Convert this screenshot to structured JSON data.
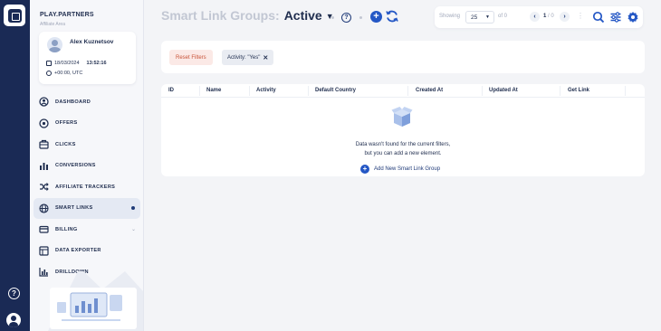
{
  "sidebar": {
    "brand": "PLAY.PARTNERS",
    "brand_sub": "Affiliate Area",
    "user": {
      "name": "Alex Kuznetsov",
      "date": "18/03/2024",
      "time": "13:52:16",
      "timezone": "+00:00, UTC"
    },
    "items": [
      {
        "label": "DASHBOARD",
        "icon": "dashboard-icon"
      },
      {
        "label": "OFFERS",
        "icon": "offers-icon"
      },
      {
        "label": "CLICKS",
        "icon": "clicks-icon"
      },
      {
        "label": "CONVERSIONS",
        "icon": "conversions-icon"
      },
      {
        "label": "AFFILIATE TRACKERS",
        "icon": "shuffle-icon"
      },
      {
        "label": "SMART LINKS",
        "icon": "globe-icon",
        "active": true
      },
      {
        "label": "BILLING",
        "icon": "billing-icon"
      },
      {
        "label": "DATA EXPORTER",
        "icon": "export-icon"
      },
      {
        "label": "DRILLDOWN",
        "icon": "drilldown-icon"
      }
    ]
  },
  "header": {
    "title": "Smart Link Groups:",
    "status": "Active",
    "help": "?",
    "add": "+"
  },
  "pager": {
    "showing_label": "Showing",
    "per_page": "25",
    "of_text": "of 0",
    "page_current": "1",
    "page_total": "/ 0",
    "prev": "‹",
    "next": "›"
  },
  "filters": {
    "reset_label": "Reset Filters",
    "chip_label": "Activity: \"Yes\"",
    "chip_close": "✕"
  },
  "table": {
    "columns": [
      "ID",
      "Name",
      "Activity",
      "Default Country",
      "Created At",
      "Updated At",
      "Get Link"
    ],
    "empty_line1": "Data wasn't found for the current filters,",
    "empty_line2": "but you can add a new element.",
    "add_label": "Add New Smart Link Group"
  },
  "colors": {
    "accent": "#2457c5",
    "navy": "#1a2a55",
    "reset_bg": "#fbe9e6",
    "reset_text": "#c9553a"
  }
}
